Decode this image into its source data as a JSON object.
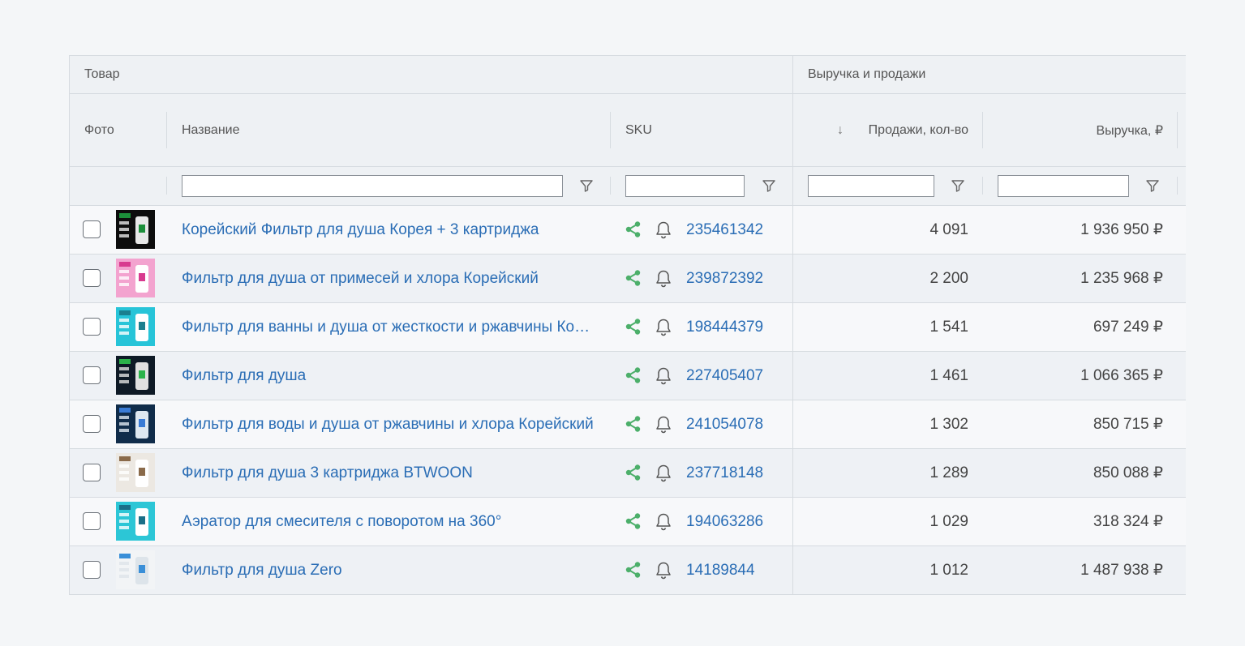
{
  "groups": {
    "product": "Товар",
    "revenue_sales": "Выручка и продажи"
  },
  "columns": {
    "photo": "Фото",
    "name": "Название",
    "sku": "SKU",
    "sales_qty": "Продажи, кол-во",
    "revenue": "Выручка, ₽",
    "sort_indicator": "↓"
  },
  "filters": {
    "name": "",
    "sku": "",
    "sales_qty": "",
    "revenue": ""
  },
  "icons": {
    "filter": "filter-funnel-icon",
    "share": "share-icon",
    "bell": "bell-icon",
    "checkbox": "checkbox"
  },
  "colors": {
    "link": "#2a6db5",
    "share": "#4caf6a",
    "border": "#d6dbe0",
    "header_bg": "#eef1f4"
  },
  "rows": [
    {
      "name": "Корейский Фильтр для душа Корея + 3 картриджа",
      "sku": "235461342",
      "qty": "4 091",
      "revenue": "1 936 950 ₽",
      "thumb": [
        "#0d0d0d",
        "#e8e8e8",
        "#1c8f3a"
      ]
    },
    {
      "name": "Фильтр для душа от примесей и хлора Корейский",
      "sku": "239872392",
      "qty": "2 200",
      "revenue": "1 235 968 ₽",
      "thumb": [
        "#f3a3cf",
        "#ffffff",
        "#d83a8f"
      ]
    },
    {
      "name": "Фильтр для ванны и душа от жесткости и ржавчины Корейский",
      "sku": "198444379",
      "qty": "1 541",
      "revenue": "697 249 ₽",
      "thumb": [
        "#27c4d8",
        "#ffffff",
        "#1b7f8f"
      ]
    },
    {
      "name": "Фильтр для душа",
      "sku": "227405407",
      "qty": "1 461",
      "revenue": "1 066 365 ₽",
      "thumb": [
        "#0e1a26",
        "#e0e0e0",
        "#2bb34a"
      ]
    },
    {
      "name": "Фильтр для воды и душа от ржавчины и хлора Корейский",
      "sku": "241054078",
      "qty": "1 302",
      "revenue": "850 715 ₽",
      "thumb": [
        "#102c4a",
        "#dfe8f0",
        "#3a7bd5"
      ]
    },
    {
      "name": "Фильтр для душа 3 картриджа BTWOON",
      "sku": "237718148",
      "qty": "1 289",
      "revenue": "850 088 ₽",
      "thumb": [
        "#ece8e2",
        "#ffffff",
        "#8a6a4a"
      ]
    },
    {
      "name": "Аэратор для смесителя с поворотом на 360°",
      "sku": "194063286",
      "qty": "1 029",
      "revenue": "318 324 ₽",
      "thumb": [
        "#2cc6d6",
        "#ffffff",
        "#1a6f88"
      ]
    },
    {
      "name": "Фильтр для душа Zero",
      "sku": "14189844",
      "qty": "1 012",
      "revenue": "1 487 938 ₽",
      "thumb": [
        "#f2f4f6",
        "#dde4ea",
        "#3a8fd8"
      ]
    }
  ]
}
